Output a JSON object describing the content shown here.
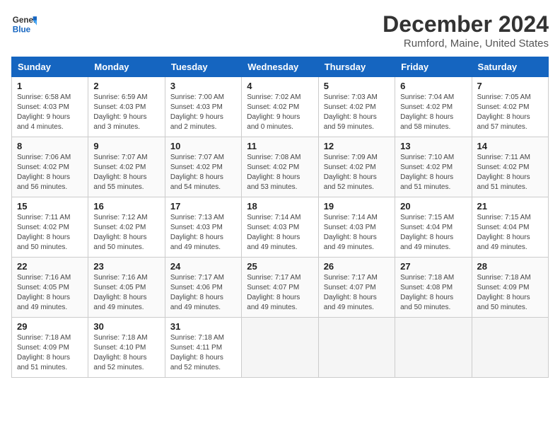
{
  "header": {
    "logo_general": "General",
    "logo_blue": "Blue",
    "month_title": "December 2024",
    "location": "Rumford, Maine, United States"
  },
  "days_of_week": [
    "Sunday",
    "Monday",
    "Tuesday",
    "Wednesday",
    "Thursday",
    "Friday",
    "Saturday"
  ],
  "weeks": [
    [
      {
        "num": "1",
        "sunrise": "6:58 AM",
        "sunset": "4:03 PM",
        "daylight": "9 hours and 4 minutes."
      },
      {
        "num": "2",
        "sunrise": "6:59 AM",
        "sunset": "4:03 PM",
        "daylight": "9 hours and 3 minutes."
      },
      {
        "num": "3",
        "sunrise": "7:00 AM",
        "sunset": "4:03 PM",
        "daylight": "9 hours and 2 minutes."
      },
      {
        "num": "4",
        "sunrise": "7:02 AM",
        "sunset": "4:02 PM",
        "daylight": "9 hours and 0 minutes."
      },
      {
        "num": "5",
        "sunrise": "7:03 AM",
        "sunset": "4:02 PM",
        "daylight": "8 hours and 59 minutes."
      },
      {
        "num": "6",
        "sunrise": "7:04 AM",
        "sunset": "4:02 PM",
        "daylight": "8 hours and 58 minutes."
      },
      {
        "num": "7",
        "sunrise": "7:05 AM",
        "sunset": "4:02 PM",
        "daylight": "8 hours and 57 minutes."
      }
    ],
    [
      {
        "num": "8",
        "sunrise": "7:06 AM",
        "sunset": "4:02 PM",
        "daylight": "8 hours and 56 minutes."
      },
      {
        "num": "9",
        "sunrise": "7:07 AM",
        "sunset": "4:02 PM",
        "daylight": "8 hours and 55 minutes."
      },
      {
        "num": "10",
        "sunrise": "7:07 AM",
        "sunset": "4:02 PM",
        "daylight": "8 hours and 54 minutes."
      },
      {
        "num": "11",
        "sunrise": "7:08 AM",
        "sunset": "4:02 PM",
        "daylight": "8 hours and 53 minutes."
      },
      {
        "num": "12",
        "sunrise": "7:09 AM",
        "sunset": "4:02 PM",
        "daylight": "8 hours and 52 minutes."
      },
      {
        "num": "13",
        "sunrise": "7:10 AM",
        "sunset": "4:02 PM",
        "daylight": "8 hours and 51 minutes."
      },
      {
        "num": "14",
        "sunrise": "7:11 AM",
        "sunset": "4:02 PM",
        "daylight": "8 hours and 51 minutes."
      }
    ],
    [
      {
        "num": "15",
        "sunrise": "7:11 AM",
        "sunset": "4:02 PM",
        "daylight": "8 hours and 50 minutes."
      },
      {
        "num": "16",
        "sunrise": "7:12 AM",
        "sunset": "4:02 PM",
        "daylight": "8 hours and 50 minutes."
      },
      {
        "num": "17",
        "sunrise": "7:13 AM",
        "sunset": "4:03 PM",
        "daylight": "8 hours and 49 minutes."
      },
      {
        "num": "18",
        "sunrise": "7:14 AM",
        "sunset": "4:03 PM",
        "daylight": "8 hours and 49 minutes."
      },
      {
        "num": "19",
        "sunrise": "7:14 AM",
        "sunset": "4:03 PM",
        "daylight": "8 hours and 49 minutes."
      },
      {
        "num": "20",
        "sunrise": "7:15 AM",
        "sunset": "4:04 PM",
        "daylight": "8 hours and 49 minutes."
      },
      {
        "num": "21",
        "sunrise": "7:15 AM",
        "sunset": "4:04 PM",
        "daylight": "8 hours and 49 minutes."
      }
    ],
    [
      {
        "num": "22",
        "sunrise": "7:16 AM",
        "sunset": "4:05 PM",
        "daylight": "8 hours and 49 minutes."
      },
      {
        "num": "23",
        "sunrise": "7:16 AM",
        "sunset": "4:05 PM",
        "daylight": "8 hours and 49 minutes."
      },
      {
        "num": "24",
        "sunrise": "7:17 AM",
        "sunset": "4:06 PM",
        "daylight": "8 hours and 49 minutes."
      },
      {
        "num": "25",
        "sunrise": "7:17 AM",
        "sunset": "4:07 PM",
        "daylight": "8 hours and 49 minutes."
      },
      {
        "num": "26",
        "sunrise": "7:17 AM",
        "sunset": "4:07 PM",
        "daylight": "8 hours and 49 minutes."
      },
      {
        "num": "27",
        "sunrise": "7:18 AM",
        "sunset": "4:08 PM",
        "daylight": "8 hours and 50 minutes."
      },
      {
        "num": "28",
        "sunrise": "7:18 AM",
        "sunset": "4:09 PM",
        "daylight": "8 hours and 50 minutes."
      }
    ],
    [
      {
        "num": "29",
        "sunrise": "7:18 AM",
        "sunset": "4:09 PM",
        "daylight": "8 hours and 51 minutes."
      },
      {
        "num": "30",
        "sunrise": "7:18 AM",
        "sunset": "4:10 PM",
        "daylight": "8 hours and 52 minutes."
      },
      {
        "num": "31",
        "sunrise": "7:18 AM",
        "sunset": "4:11 PM",
        "daylight": "8 hours and 52 minutes."
      },
      null,
      null,
      null,
      null
    ]
  ],
  "labels": {
    "sunrise": "Sunrise:",
    "sunset": "Sunset:",
    "daylight": "Daylight:"
  }
}
